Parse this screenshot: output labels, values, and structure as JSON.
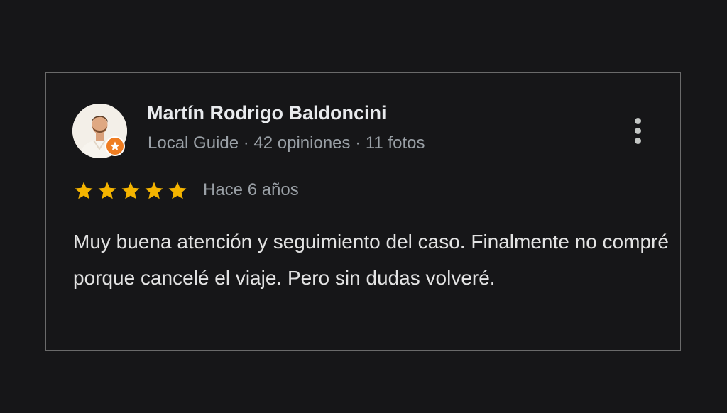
{
  "review": {
    "author_name": "Martín Rodrigo Baldoncini",
    "author_meta": "Local Guide · 42 opiniones · 11 fotos",
    "rating": 5,
    "rating_max": 5,
    "time_ago": "Hace 6 años",
    "text": "Muy buena atención y seguimiento del caso. Finalmente no compré porque cancelé el viaje. Pero sin dudas volveré."
  },
  "icons": {
    "avatar": "user-avatar-photo",
    "badge": "local-guide-star-badge-icon",
    "more": "more-vert-icon",
    "star": "star-icon"
  },
  "colors": {
    "background": "#161618",
    "star": "#f4b400",
    "badge": "#ef7d22",
    "name": "#e8eaed",
    "secondary": "#9aa0a6"
  }
}
